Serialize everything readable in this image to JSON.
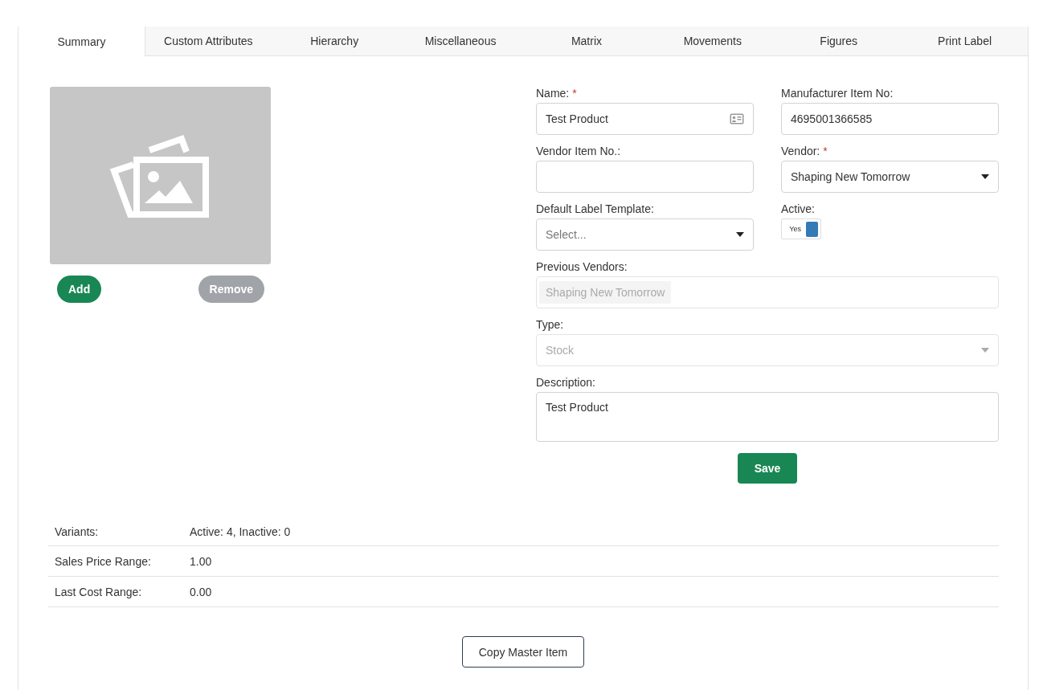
{
  "tabs": [
    {
      "label": "Summary",
      "selected": true
    },
    {
      "label": "Custom Attributes",
      "selected": false
    },
    {
      "label": "Hierarchy",
      "selected": false
    },
    {
      "label": "Miscellaneous",
      "selected": false
    },
    {
      "label": "Matrix",
      "selected": false
    },
    {
      "label": "Movements",
      "selected": false
    },
    {
      "label": "Figures",
      "selected": false
    },
    {
      "label": "Print Label",
      "selected": false
    }
  ],
  "image": {
    "buttons": [
      {
        "label": "Add",
        "disabled": false
      },
      {
        "label": "Remove",
        "disabled": true
      }
    ]
  },
  "form": {
    "rows": [
      {
        "fields": [
          {
            "kind": "text-card",
            "label": "Name:",
            "required": true,
            "value": "Test Product"
          },
          {
            "kind": "text",
            "label": "Manufacturer Item No:",
            "required": false,
            "value": "4695001366585"
          }
        ]
      },
      {
        "fields": [
          {
            "kind": "text",
            "label": "Vendor Item No.:",
            "required": false
          },
          {
            "kind": "select",
            "label": "Vendor:",
            "required": true,
            "value": "Shaping New Tomorrow"
          }
        ]
      },
      {
        "fields": [
          {
            "kind": "select",
            "label": "Default Label Template:",
            "required": false,
            "placeholder": "Select..."
          },
          {
            "kind": "toggle",
            "label": "Active:",
            "required": false,
            "value": "Yes",
            "on": true
          }
        ]
      },
      {
        "fields": [
          {
            "kind": "tags",
            "label": "Previous Vendors:",
            "required": false,
            "tags": [
              "Shaping New Tomorrow"
            ],
            "disabled": true
          }
        ]
      },
      {
        "fields": [
          {
            "kind": "select",
            "label": "Type:",
            "required": false,
            "value": "Stock",
            "disabled": true
          }
        ]
      },
      {
        "fields": [
          {
            "kind": "textarea",
            "label": "Description:",
            "required": false,
            "value": "Test Product"
          }
        ]
      }
    ],
    "save": "Save",
    "required_mark": "*"
  },
  "summary": [
    {
      "label": "Variants:",
      "value": "Active: 4, Inactive: 0"
    },
    {
      "label": "Sales Price Range:",
      "value": "1.00"
    },
    {
      "label": "Last Cost Range:",
      "value": "0.00"
    }
  ],
  "copy_button": "Copy Master Item"
}
